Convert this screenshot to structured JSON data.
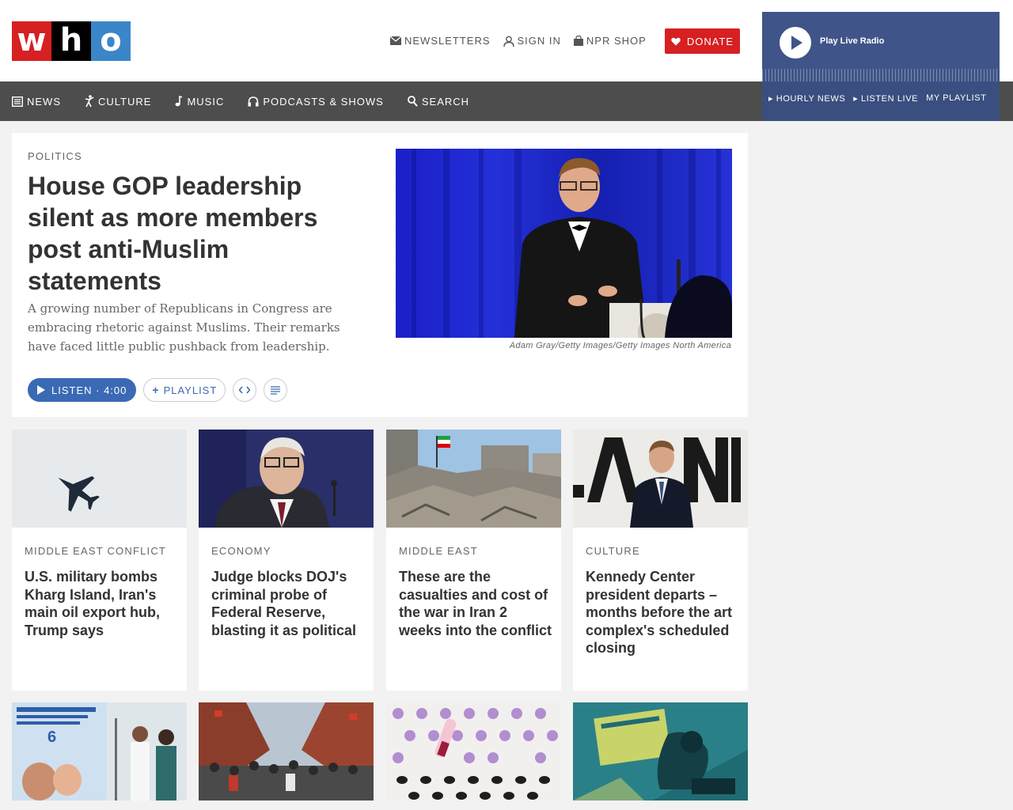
{
  "brand": {
    "logo_letters": [
      "w",
      "h",
      "o"
    ],
    "colors": {
      "red": "#d62021",
      "black": "#000000",
      "blue": "#3a86c8",
      "accent": "#3a6ab5",
      "nav_bg": "#4d4d4d",
      "radio_bg": "#3f5488"
    }
  },
  "header": {
    "links": [
      {
        "label": "NEWSLETTERS",
        "icon": "mail-icon"
      },
      {
        "label": "SIGN IN",
        "icon": "user-icon"
      },
      {
        "label": "NPR SHOP",
        "icon": "shopping-bag-icon"
      }
    ],
    "donate_label": "DONATE"
  },
  "nav": {
    "items": [
      {
        "label": "NEWS",
        "icon": "newspaper-icon"
      },
      {
        "label": "CULTURE",
        "icon": "dancer-icon"
      },
      {
        "label": "MUSIC",
        "icon": "music-note-icon"
      },
      {
        "label": "PODCASTS & SHOWS",
        "icon": "headphones-icon"
      },
      {
        "label": "SEARCH",
        "icon": "search-icon"
      }
    ]
  },
  "radio": {
    "title": "Play Live Radio",
    "links": [
      "HOURLY NEWS",
      "LISTEN LIVE",
      "MY PLAYLIST"
    ]
  },
  "feature": {
    "slug": "POLITICS",
    "headline": "House GOP leadership silent as more members post anti-Muslim statements",
    "teaser": "A growing number of Republicans in Congress are embracing rhetoric against Muslims. Their remarks have faced little public pushback from leadership.",
    "caption": "Adam Gray/Getty Images/Getty Images North America",
    "listen_label": "LISTEN · 4:00",
    "playlist_label": "PLAYLIST"
  },
  "cards": [
    {
      "slug": "MIDDLE EAST CONFLICT",
      "headline": "U.S. military bombs Kharg Island, Iran's main oil export hub, Trump says"
    },
    {
      "slug": "ECONOMY",
      "headline": "Judge blocks DOJ's criminal probe of Federal Reserve, blasting it as political"
    },
    {
      "slug": "MIDDLE EAST",
      "headline": "These are the casualties and cost of the war in Iran 2 weeks into the conflict"
    },
    {
      "slug": "CULTURE",
      "headline": "Kennedy Center president departs – months before the art complex's scheduled closing"
    }
  ]
}
